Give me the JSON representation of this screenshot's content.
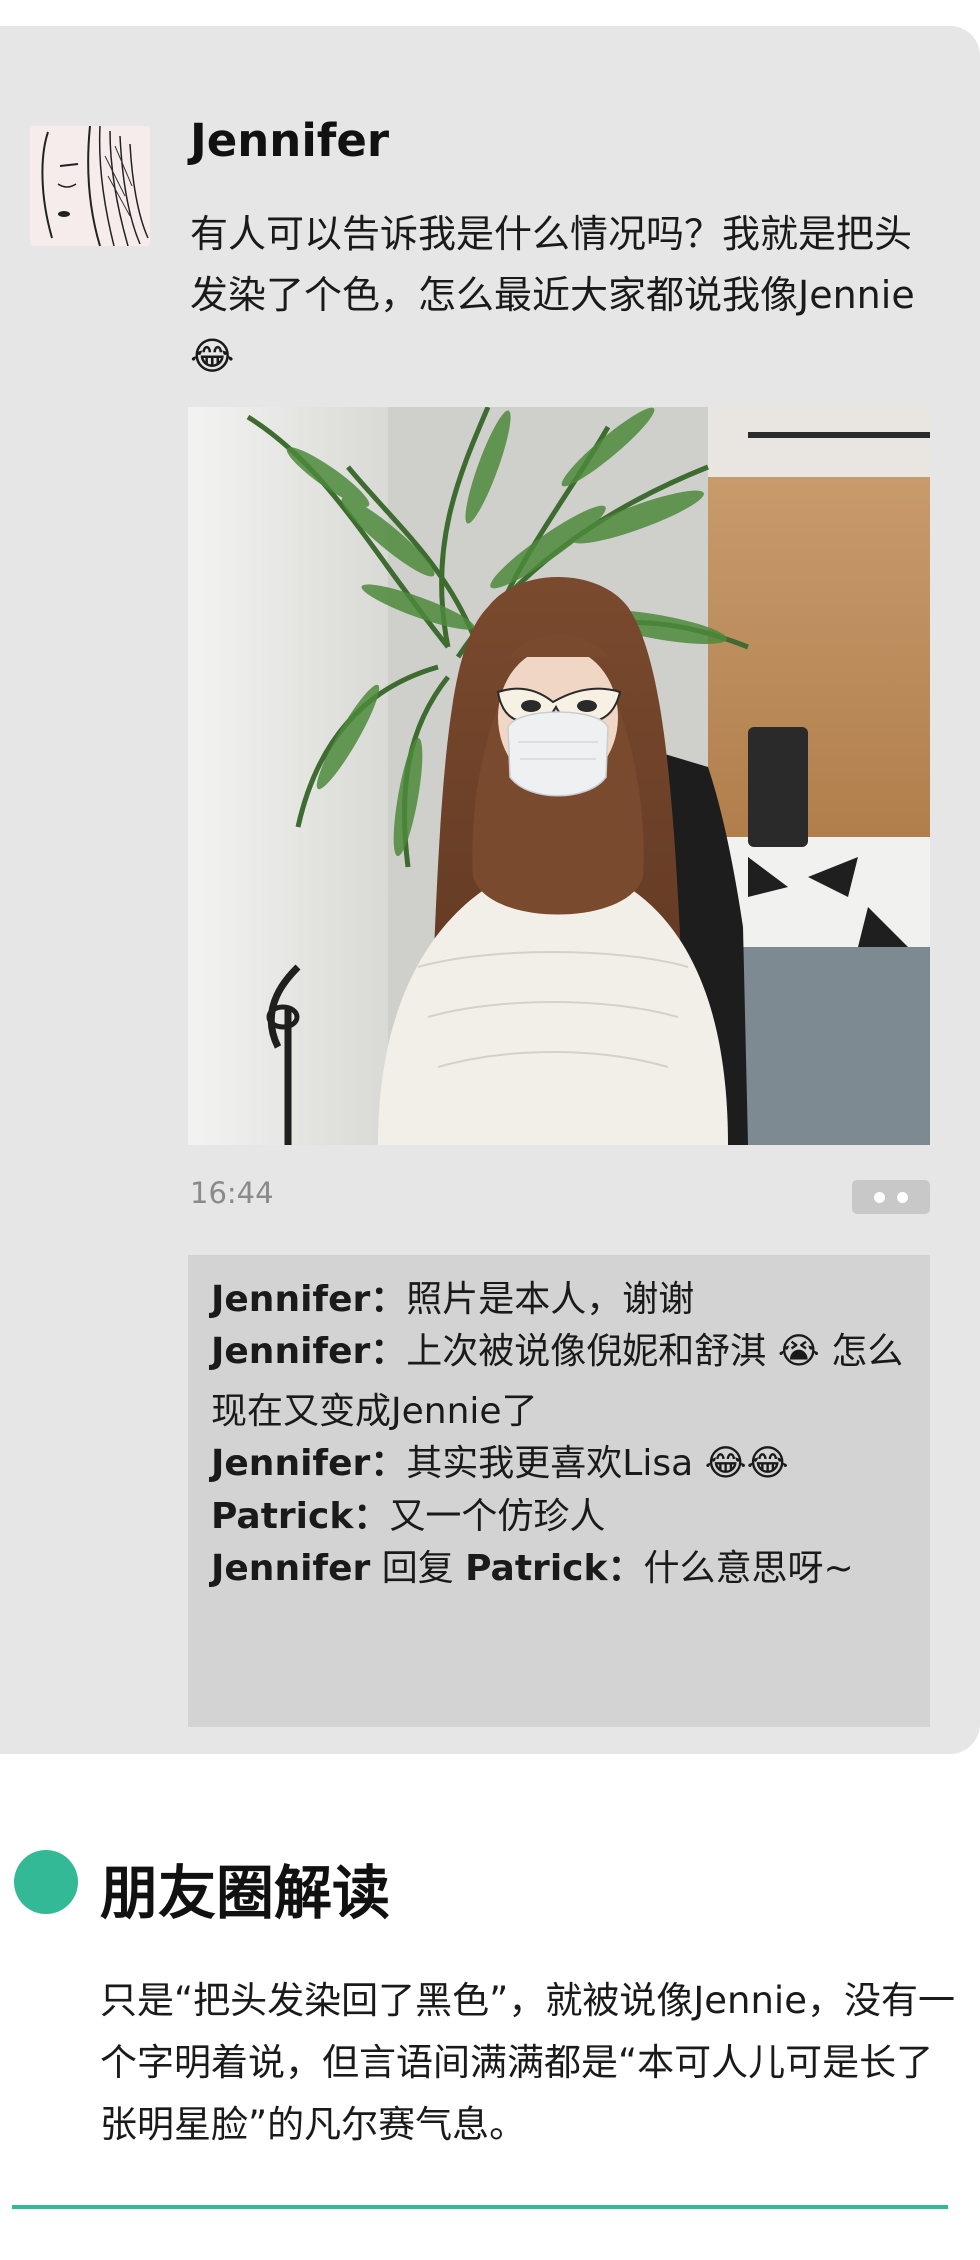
{
  "post": {
    "author": "Jennifer",
    "text": "有人可以告诉我是什么情况吗？我就是把头发染了个色，怎么最近大家都说我像Jennie😂",
    "time": "16:44"
  },
  "comments": [
    {
      "author": "Jennifer",
      "sep": "：",
      "text": "照片是本人，谢谢"
    },
    {
      "author": "Jennifer",
      "sep": "：",
      "text": "上次被说像倪妮和舒淇 😭 怎么现在又变成Jennie了"
    },
    {
      "author": "Jennifer",
      "sep": "：",
      "text": "其实我更喜欢Lisa 😂😂"
    },
    {
      "author": "Patrick",
      "sep": "：",
      "text": "又一个仿珍人"
    },
    {
      "author": "Jennifer",
      "reply_word": " 回复 ",
      "reply_to": "Patrick",
      "sep": "：",
      "text": "什么意思呀~"
    }
  ],
  "section": {
    "title": "朋友圈解读",
    "body": "只是“把头发染回了黑色”，就被说像Jennie，没有一个字明着说，但言语间满满都是“本可人儿可是长了张明星脸”的凡尔赛气息。"
  },
  "colors": {
    "accent": "#33b995",
    "card_bg": "#e6e6e6",
    "comment_bg": "#d3d3d3",
    "time_text": "#8a8a8a"
  },
  "icons": {
    "more": "more-dots-icon",
    "section_marker": "green-dot-icon"
  }
}
